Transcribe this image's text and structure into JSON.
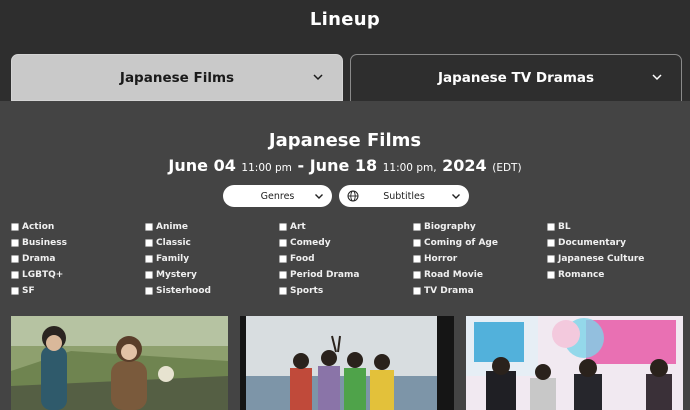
{
  "header": {
    "title": "Lineup"
  },
  "tabs": [
    {
      "label": "Japanese Films",
      "active": true
    },
    {
      "label": "Japanese TV Dramas",
      "active": false
    }
  ],
  "section": {
    "title": "Japanese Films",
    "start_date": "June 04",
    "start_time": "11:00 pm",
    "separator": "-",
    "end_date": "June 18",
    "end_time": "11:00 pm,",
    "year": "2024",
    "timezone": "(EDT)"
  },
  "filters": {
    "genres_label": "Genres",
    "subtitles_label": "Subtitles"
  },
  "genres": [
    [
      "Action",
      "Anime",
      "Art",
      "Biography",
      "BL"
    ],
    [
      "Business",
      "Classic",
      "Comedy",
      "Coming of Age",
      "Documentary"
    ],
    [
      "Drama",
      "Family",
      "Food",
      "Horror",
      "Japanese Culture"
    ],
    [
      "LGBTQ+",
      "Mystery",
      "Period Drama",
      "Road Movie",
      "Romance"
    ],
    [
      "SF",
      "Sisterhood",
      "Sports",
      "TV Drama"
    ]
  ],
  "colors": {
    "page_bg": "#2e2e2e",
    "panel_bg": "#444444",
    "active_tab_bg": "#c9c9c9"
  },
  "icons": {
    "tab_chevron": "chevron-down-icon",
    "pill_chevron": "chevron-down-icon",
    "subtitles": "globe-icon"
  }
}
